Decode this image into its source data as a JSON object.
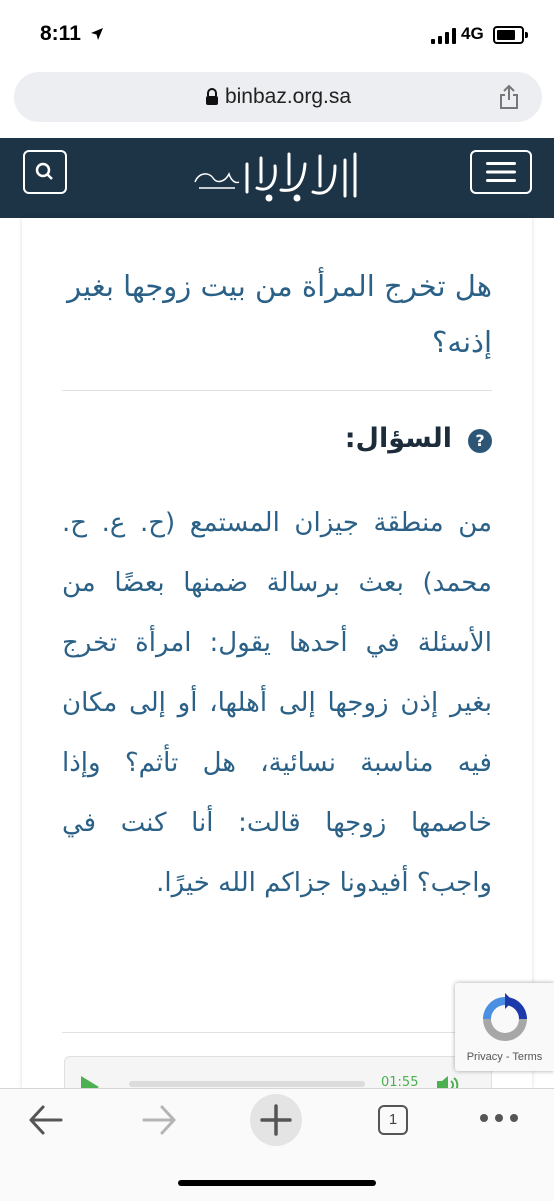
{
  "status_bar": {
    "time": "8:11",
    "network": "4G"
  },
  "browser": {
    "url": "binbaz.org.sa"
  },
  "site": {
    "logo_text": "الإمام ابن باز رحمه الله"
  },
  "article": {
    "title": "هل تخرج المرأة من بيت زوجها بغير إذنه؟",
    "question_label": "السؤال:",
    "question_icon": "?",
    "question_text": "من منطقة جيزان المستمع (ح. ع. ح. محمد) بعث برسالة ضمنها بعضًا من الأسئلة في أحدها يقول: امرأة تخرج بغير إذن زوجها إلى أهلها، أو إلى مكان فيه مناسبة نسائية، هل تأثم؟ وإذا خاصمها زوجها قالت: أنا كنت في واجب؟ أفيدونا جزاكم الله خيرًا."
  },
  "audio_player": {
    "time": "01:55"
  },
  "recaptcha": {
    "privacy": "Privacy",
    "separator": " - ",
    "terms": "Terms"
  },
  "toolbar": {
    "tab_count": "1"
  },
  "colors": {
    "navbar": "#1d3346",
    "title_blue": "#2b6187",
    "audio_green": "#4caf50"
  }
}
